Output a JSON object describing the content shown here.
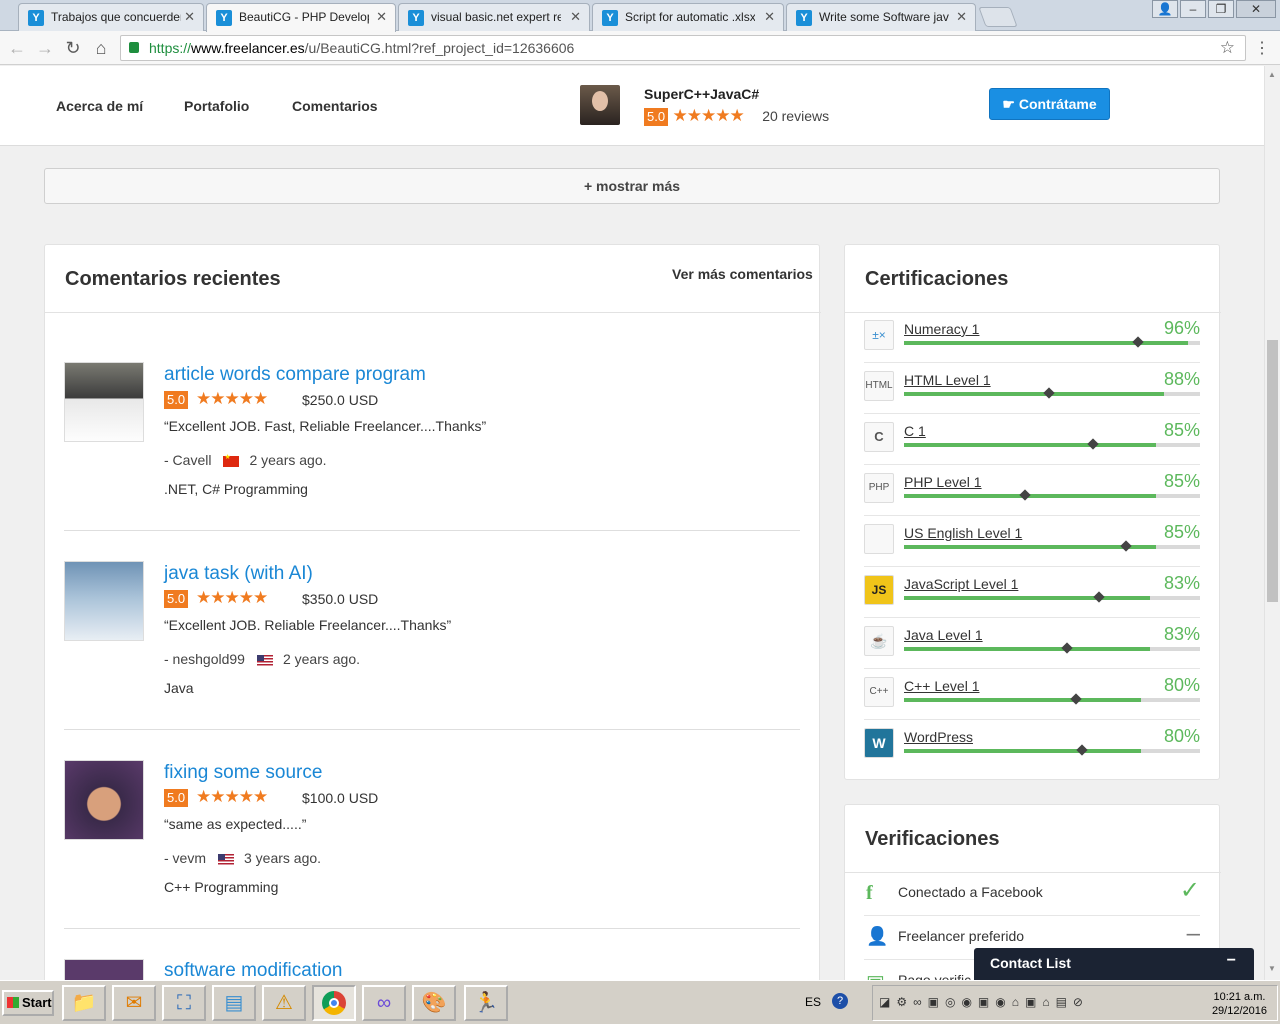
{
  "browser": {
    "tabs": [
      {
        "title": "Trabajos que concuerden c",
        "active": false
      },
      {
        "title": "BeautiCG - PHP Developer",
        "active": true
      },
      {
        "title": "visual basic.net expert requ",
        "active": false
      },
      {
        "title": "Script for automatic .xlsx o",
        "active": false
      },
      {
        "title": "Write some Software java",
        "active": false
      }
    ],
    "url_scheme": "https://",
    "url_host": "www.freelancer.es",
    "url_path": "/u/BeautiCG.html?ref_project_id=12636606"
  },
  "subnav": {
    "links": [
      "Acerca de mí",
      "Portafolio",
      "Comentarios"
    ],
    "username": "SuperC++JavaC#",
    "score": "5.0",
    "reviews": "20 reviews",
    "hire_label": "Contrátame"
  },
  "show_more": "+ mostrar más",
  "reviews_card": {
    "title": "Comentarios recientes",
    "see_all": "Ver más comentarios",
    "items": [
      {
        "title": "article words compare program",
        "score": "5.0",
        "price": "$250.0 USD",
        "quote": "“Excellent JOB. Fast, Reliable Freelancer....Thanks”",
        "author": "- Cavell",
        "country": "cn",
        "when": "2 years ago.",
        "skills": ".NET, C# Programming"
      },
      {
        "title": "java task (with AI)",
        "score": "5.0",
        "price": "$350.0 USD",
        "quote": "“Excellent JOB. Reliable Freelancer....Thanks”",
        "author": "- neshgold99",
        "country": "us",
        "when": "2 years ago.",
        "skills": "Java"
      },
      {
        "title": "fixing some source",
        "score": "5.0",
        "price": "$100.0 USD",
        "quote": "“same as expected.....”",
        "author": "- vevm",
        "country": "us",
        "when": "3 years ago.",
        "skills": "C++ Programming"
      },
      {
        "title": "software modification",
        "score": "",
        "price": "",
        "quote": "",
        "author": "",
        "country": "",
        "when": "",
        "skills": ""
      }
    ]
  },
  "certs_card": {
    "title": "Certificaciones",
    "items": [
      {
        "name": "Numeracy 1",
        "pct": "96%",
        "value": 0.96,
        "avg": 0.79,
        "icon": "math-icon",
        "glyph": "±×"
      },
      {
        "name": "HTML Level 1",
        "pct": "88%",
        "value": 0.88,
        "avg": 0.49,
        "icon": "html-icon",
        "glyph": "HTML"
      },
      {
        "name": "C 1",
        "pct": "85%",
        "value": 0.85,
        "avg": 0.64,
        "icon": "c-icon",
        "glyph": "C"
      },
      {
        "name": "PHP Level 1",
        "pct": "85%",
        "value": 0.85,
        "avg": 0.41,
        "icon": "php-icon",
        "glyph": "PHP"
      },
      {
        "name": "US English Level 1",
        "pct": "85%",
        "value": 0.85,
        "avg": 0.75,
        "icon": "us-flag-icon",
        "glyph": ""
      },
      {
        "name": "JavaScript Level 1",
        "pct": "83%",
        "value": 0.83,
        "avg": 0.66,
        "icon": "js-icon",
        "glyph": "JS"
      },
      {
        "name": "Java Level 1",
        "pct": "83%",
        "value": 0.83,
        "avg": 0.55,
        "icon": "java-icon",
        "glyph": "☕"
      },
      {
        "name": "C++ Level 1",
        "pct": "80%",
        "value": 0.8,
        "avg": 0.58,
        "icon": "cpp-icon",
        "glyph": "C++"
      },
      {
        "name": "WordPress",
        "pct": "80%",
        "value": 0.8,
        "avg": 0.6,
        "icon": "wordpress-icon",
        "glyph": "W"
      }
    ]
  },
  "verif_card": {
    "title": "Verificaciones",
    "items": [
      {
        "label": "Conectado a Facebook",
        "icon": "facebook-icon",
        "status": "✓",
        "status_color": "#5cb85c"
      },
      {
        "label": "Freelancer preferido",
        "icon": "preferred-user-icon",
        "status": "–",
        "status_color": "#777"
      },
      {
        "label": "Pago verific",
        "icon": "payment-icon",
        "status": "",
        "status_color": "#777"
      }
    ]
  },
  "contact_list": {
    "label": "Contact List",
    "min": "−"
  },
  "taskbar": {
    "start": "Start",
    "lang": "ES",
    "time": "10:21 a.m.",
    "date": "29/12/2016"
  },
  "colors": {
    "accent": "#1a8fe3",
    "score": "#f07b20",
    "success": "#5cb85c",
    "link": "#1a87d5"
  }
}
